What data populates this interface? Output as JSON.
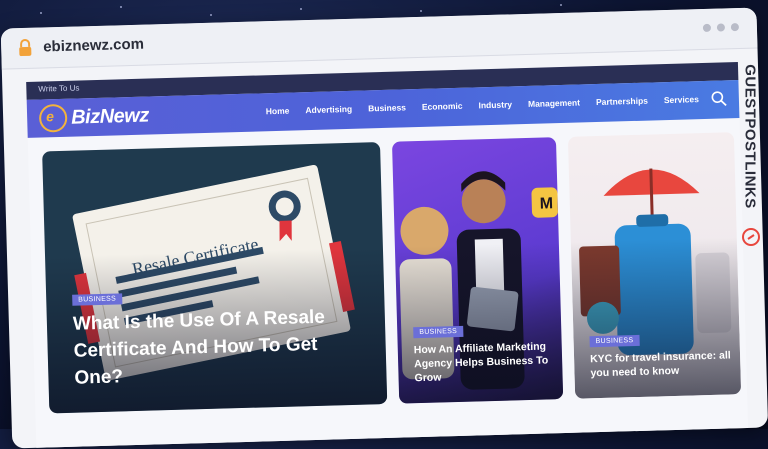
{
  "browser": {
    "url": "ebiznewz.com"
  },
  "site": {
    "topbar_link": "Write To Us",
    "logo_text": "Newz",
    "logo_prefix": "Biz",
    "nav": [
      "Home",
      "Advertising",
      "Business",
      "Economic",
      "Industry",
      "Management",
      "Partnerships",
      "Services"
    ]
  },
  "cards": [
    {
      "badge": "BUSINESS",
      "title": "What Is the Use Of A Resale Certificate And How To Get One?",
      "image_text": "Resale Certificate"
    },
    {
      "badge": "BUSINESS",
      "title": "How An Affiliate Marketing Agency Helps Business To Grow"
    },
    {
      "badge": "BUSINESS",
      "title": "KYC for travel insurance: all you need to know"
    }
  ],
  "rail": {
    "label": "GUESTPOSTLINKS"
  },
  "colors": {
    "navbar_start": "#5a5fd6",
    "navbar_end": "#4a7be2",
    "badge": "#6b6fd8",
    "topbar": "#2a2f55"
  }
}
